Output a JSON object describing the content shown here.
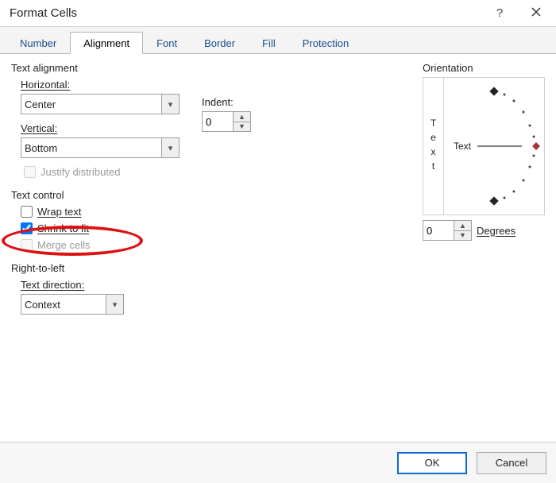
{
  "title": "Format Cells",
  "tabs": [
    "Number",
    "Alignment",
    "Font",
    "Border",
    "Fill",
    "Protection"
  ],
  "active_tab_index": 1,
  "alignment": {
    "section_label": "Text alignment",
    "horizontal_label": "Horizontal:",
    "horizontal_value": "Center",
    "indent_label": "Indent:",
    "indent_value": "0",
    "vertical_label": "Vertical:",
    "vertical_value": "Bottom",
    "justify_label": "Justify distributed",
    "justify_checked": false,
    "justify_enabled": false
  },
  "text_control": {
    "section_label": "Text control",
    "wrap_label": "Wrap text",
    "wrap_checked": false,
    "shrink_label": "Shrink to fit",
    "shrink_checked": true,
    "merge_label": "Merge cells",
    "merge_checked": false,
    "merge_enabled": false
  },
  "rtl": {
    "section_label": "Right-to-left",
    "direction_label": "Text direction:",
    "direction_value": "Context"
  },
  "orientation": {
    "section_label": "Orientation",
    "vertical_word": "Text",
    "center_word": "Text",
    "degrees_value": "0",
    "degrees_label": "Degrees"
  },
  "footer": {
    "ok": "OK",
    "cancel": "Cancel"
  }
}
